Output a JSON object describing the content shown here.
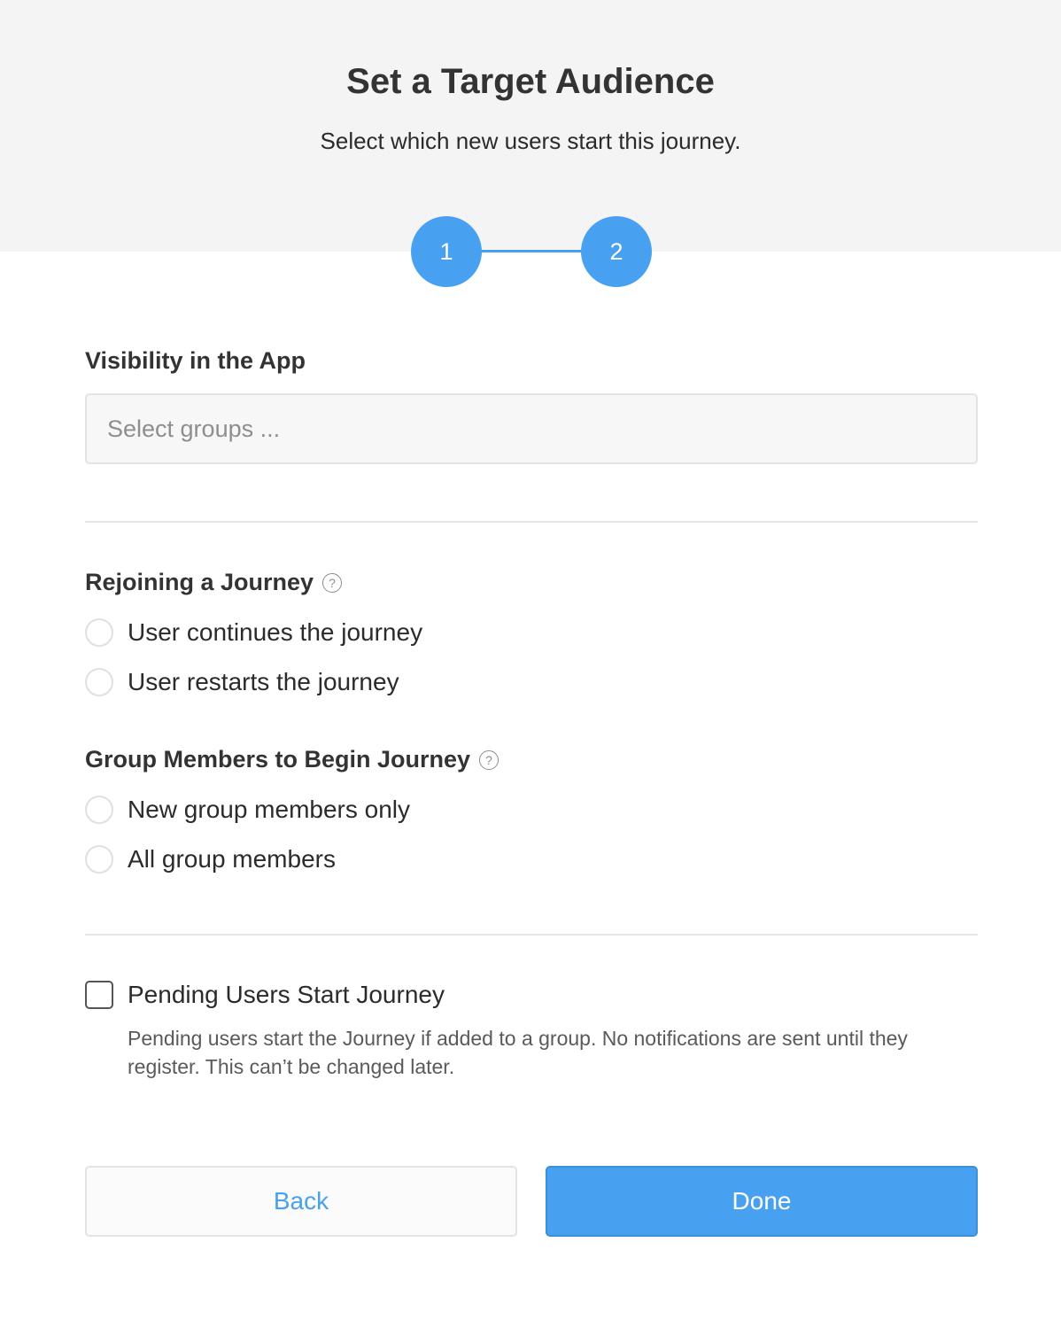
{
  "header": {
    "title": "Set a Target Audience",
    "subtitle": "Select which new users start this journey."
  },
  "stepper": {
    "steps": [
      "1",
      "2"
    ],
    "current": 2,
    "active_color": "#48a1f0"
  },
  "visibility": {
    "label": "Visibility in the App",
    "placeholder": "Select groups ..."
  },
  "rejoining": {
    "label": "Rejoining a Journey",
    "help_icon": "question-circle-icon",
    "options": [
      "User continues the journey",
      "User restarts the journey"
    ]
  },
  "group_members": {
    "label": "Group Members to Begin Journey",
    "help_icon": "question-circle-icon",
    "options": [
      "New group members only",
      "All group members"
    ]
  },
  "pending": {
    "label": "Pending Users Start Journey",
    "checked": false,
    "description": "Pending users start the Journey if added to a group. No notifications are sent until they register. This can’t be changed later."
  },
  "actions": {
    "back_label": "Back",
    "done_label": "Done"
  },
  "colors": {
    "accent": "#48a1f0",
    "header_bg": "#f4f4f4"
  }
}
